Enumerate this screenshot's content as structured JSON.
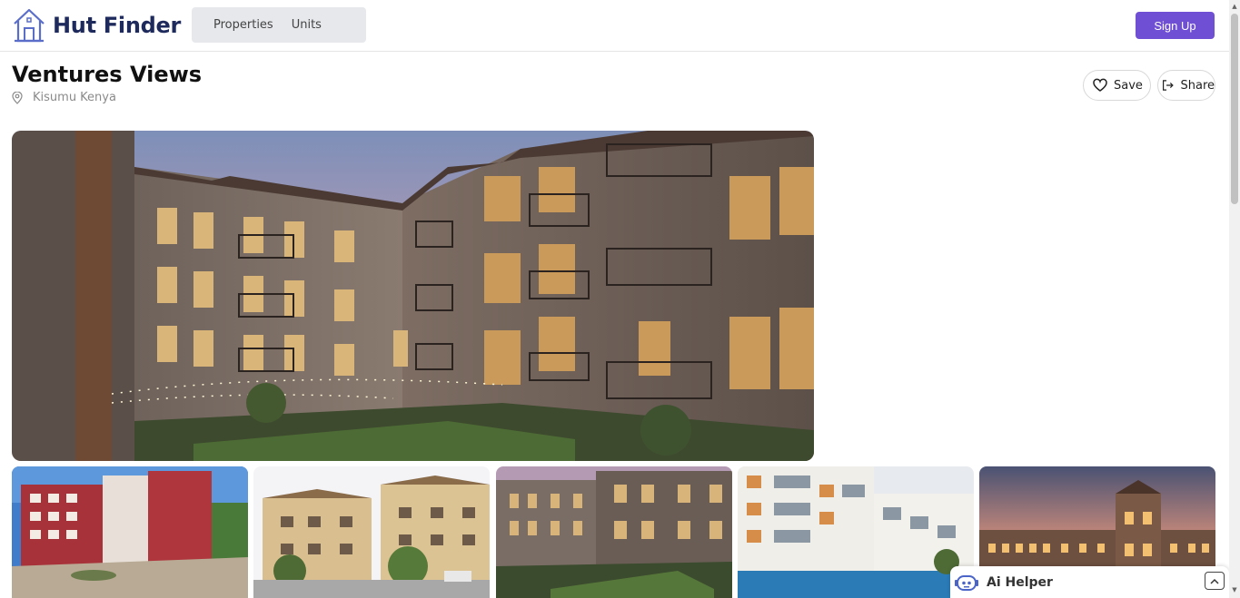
{
  "app": {
    "name": "Hut Finder"
  },
  "nav": {
    "properties": "Properties",
    "units": "Units"
  },
  "actions": {
    "signup": "Sign Up",
    "save": "Save",
    "share": "Share"
  },
  "property": {
    "title": "Ventures Views",
    "location": "Kisumu Kenya"
  },
  "ai_helper": {
    "label": "Ai Helper"
  },
  "colors": {
    "brand": "#6f4fd3",
    "logo": "#1f2a5c"
  },
  "icons": {
    "logo": "house-icon",
    "location": "map-pin-icon",
    "save": "heart-icon",
    "share": "share-icon",
    "ai": "robot-icon",
    "toggle": "chevron-up-icon"
  }
}
